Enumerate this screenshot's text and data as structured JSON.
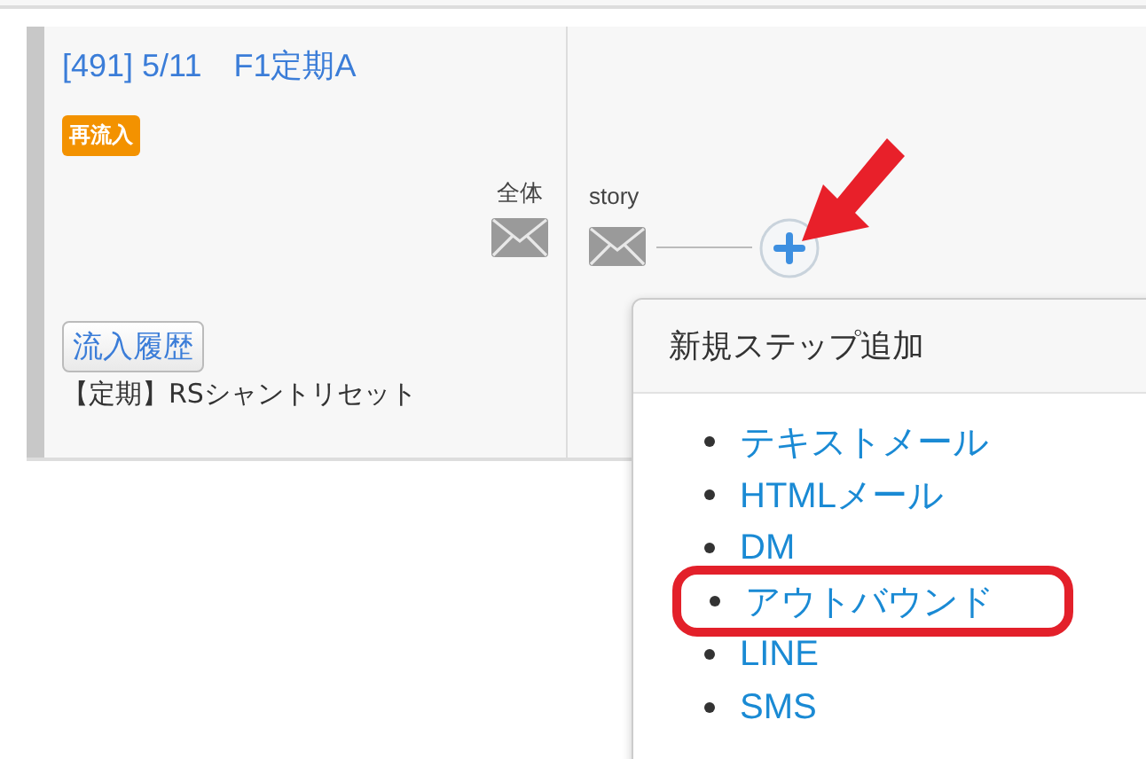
{
  "step": {
    "title": "[491] 5/11　F1定期A",
    "badge": "再流入",
    "total_label": "全体",
    "history_button": "流入履歴",
    "description": "【定期】RSシャントリセット"
  },
  "flow": {
    "node_label": "story"
  },
  "popover": {
    "title": "新規ステップ追加",
    "items": [
      {
        "label": "テキストメール",
        "highlighted": false
      },
      {
        "label": "HTMLメール",
        "highlighted": false
      },
      {
        "label": "DM",
        "highlighted": false
      },
      {
        "label": "アウトバウンド",
        "highlighted": true
      },
      {
        "label": "LINE",
        "highlighted": false
      },
      {
        "label": "SMS",
        "highlighted": false
      }
    ]
  }
}
